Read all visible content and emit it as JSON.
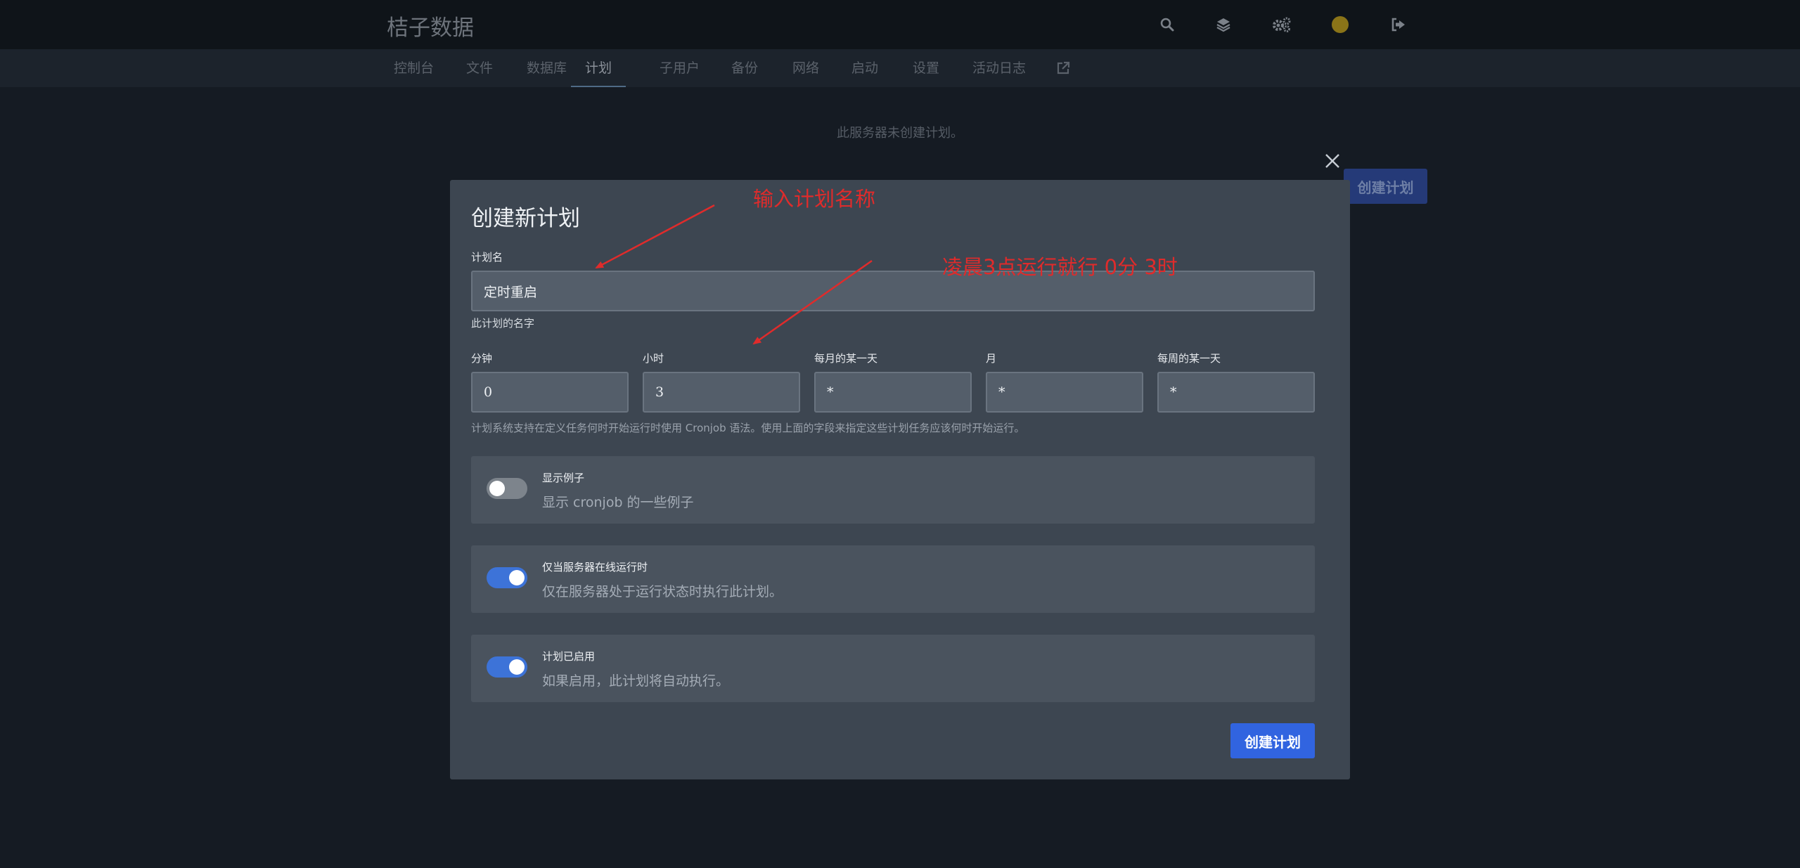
{
  "header": {
    "brand": "桔子数据",
    "icons": [
      "search-icon",
      "layers-icon",
      "cogs-icon",
      "avatar",
      "logout-icon"
    ]
  },
  "nav": {
    "items": [
      {
        "label": "控制台"
      },
      {
        "label": "文件"
      },
      {
        "label": "数据库"
      },
      {
        "label": "计划",
        "active": true
      },
      {
        "label": "子用户"
      },
      {
        "label": "备份"
      },
      {
        "label": "网络"
      },
      {
        "label": "启动"
      },
      {
        "label": "设置"
      },
      {
        "label": "活动日志"
      }
    ],
    "external_icon": "external-link-icon"
  },
  "page": {
    "empty_message": "此服务器未创建计划。",
    "create_label": "创建计划"
  },
  "modal": {
    "title": "创建新计划",
    "name_label": "计划名",
    "name_value": "定时重启",
    "name_help": "此计划的名字",
    "cron": {
      "minute": {
        "label": "分钟",
        "value": "0"
      },
      "hour": {
        "label": "小时",
        "value": "3"
      },
      "day_of_month": {
        "label": "每月的某一天",
        "value": "*"
      },
      "month": {
        "label": "月",
        "value": "*"
      },
      "day_of_week": {
        "label": "每周的某一天",
        "value": "*"
      }
    },
    "cron_help": "计划系统支持在定义任务何时开始运行时使用 Cronjob 语法。使用上面的字段来指定这些计划任务应该何时开始运行。",
    "toggles": [
      {
        "title": "显示例子",
        "description": "显示 cronjob 的一些例子",
        "on": false
      },
      {
        "title": "仅当服务器在线运行时",
        "description": "仅在服务器处于运行状态时执行此计划。",
        "on": true
      },
      {
        "title": "计划已启用",
        "description": "如果启用，此计划将自动执行。",
        "on": true
      }
    ],
    "submit_label": "创建计划"
  },
  "annotations": {
    "name_hint": "输入计划名称",
    "time_hint": "凌晨3点运行就行  0分  3时",
    "color": "#e02b2b"
  }
}
